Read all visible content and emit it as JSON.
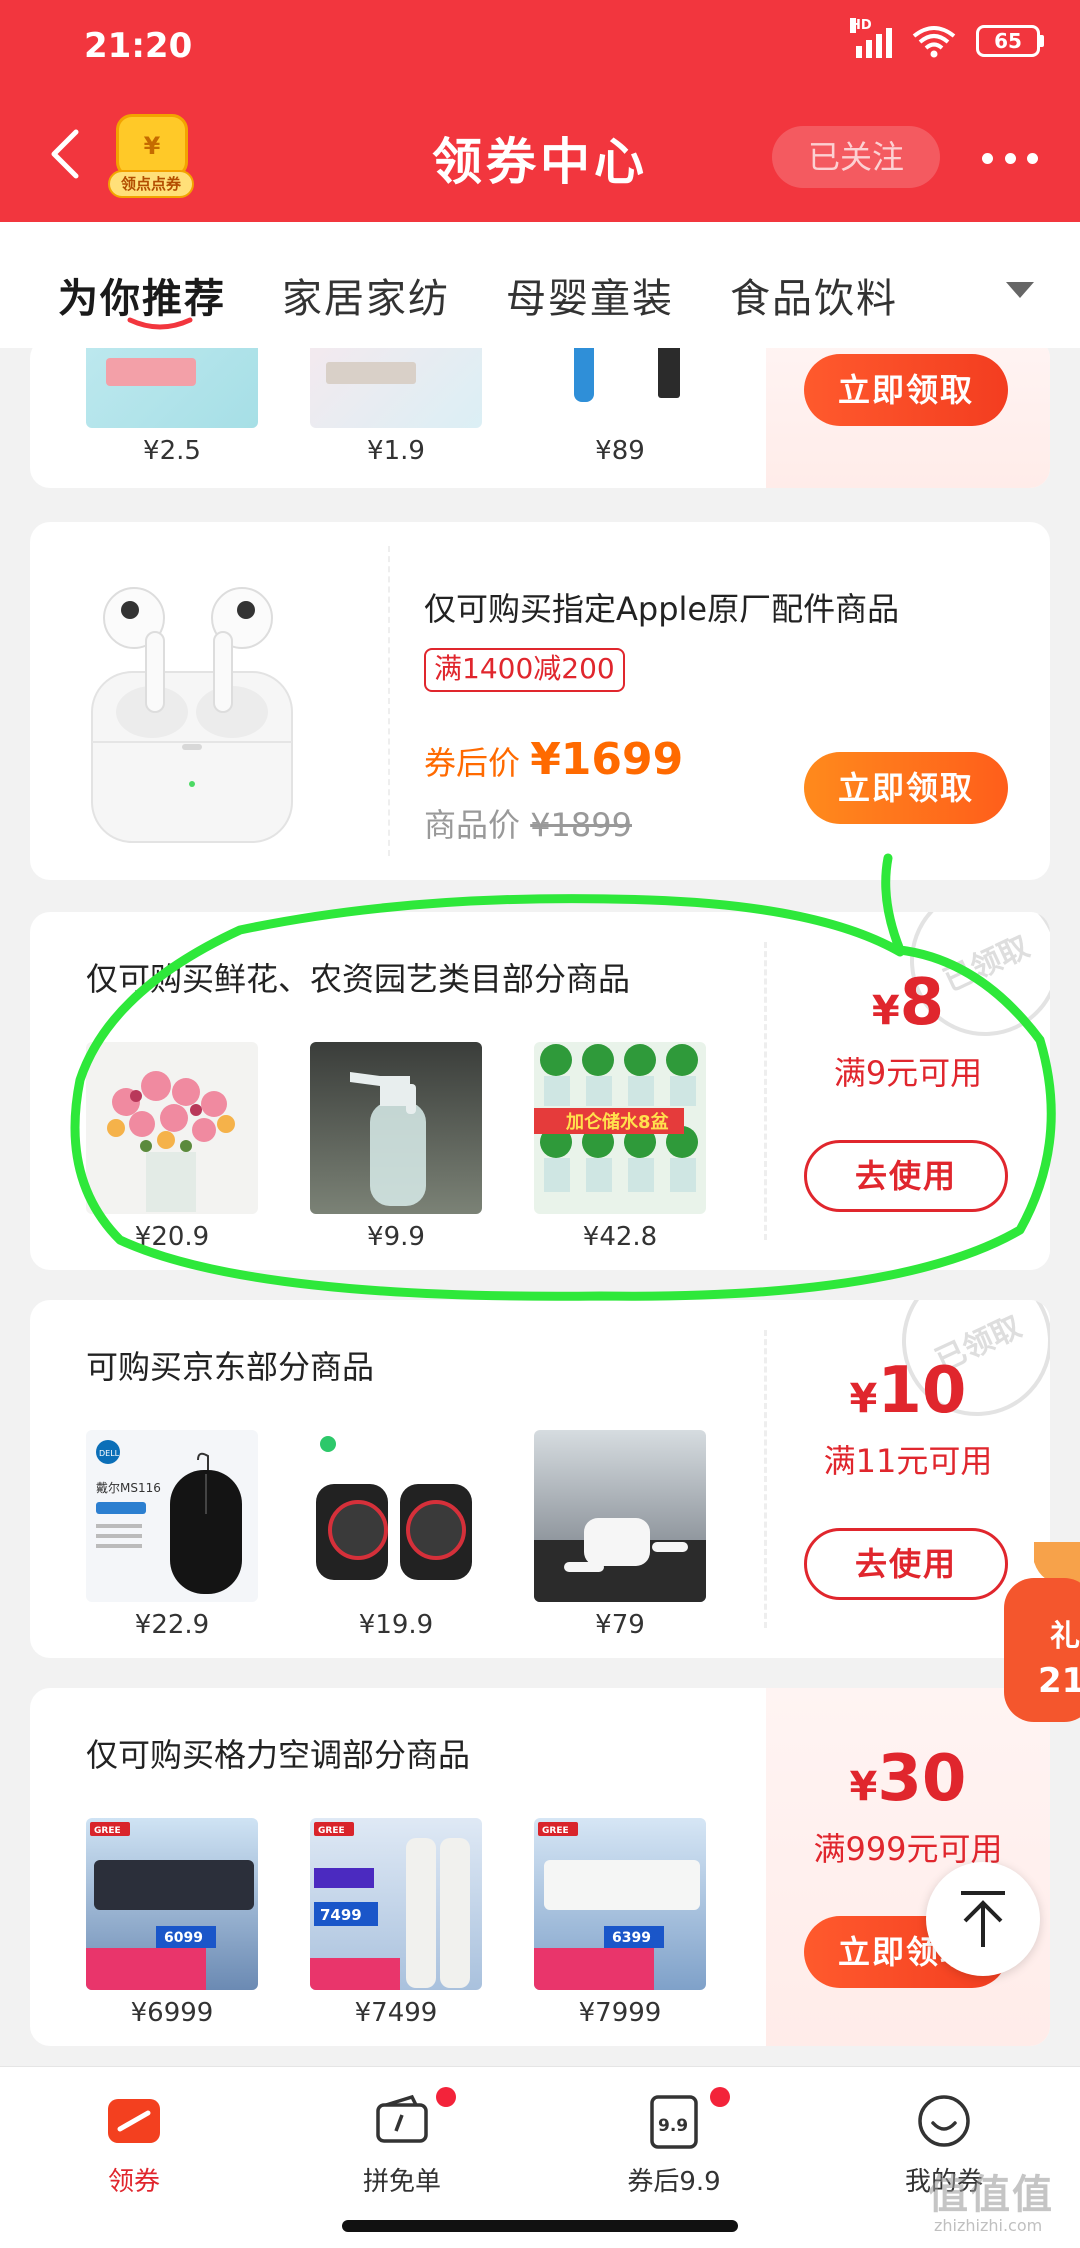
{
  "status_bar": {
    "time": "21:20",
    "network": "HD",
    "battery": "65"
  },
  "header": {
    "title": "领券中心",
    "badge_label": "领点点券",
    "badge_symbol": "¥",
    "follow_label": "已关注"
  },
  "tabs": [
    "为你推荐",
    "家居家纺",
    "母婴童装",
    "食品饮料"
  ],
  "cards": {
    "top_partial": {
      "prices": [
        "¥2.5",
        "¥1.9",
        "¥89"
      ],
      "button": "立即领取"
    },
    "apple": {
      "title": "仅可购买指定Apple原厂配件商品",
      "tag": "满1400减200",
      "after_label": "券后价",
      "after_price": "¥1699",
      "orig_label": "商品价",
      "orig_price": "¥1899",
      "button": "立即领取"
    },
    "flowers": {
      "title": "仅可购买鲜花、农资园艺类目部分商品",
      "prices": [
        "¥20.9",
        "¥9.9",
        "¥42.8"
      ],
      "coupon_symbol": "¥",
      "coupon_value": "8",
      "condition": "满9元可用",
      "button": "去使用",
      "stamp": "已领取",
      "thumb3_banner": "加仑储水8盆"
    },
    "jd": {
      "title": "可购买京东部分商品",
      "prices": [
        "¥22.9",
        "¥19.9",
        "¥79"
      ],
      "coupon_symbol": "¥",
      "coupon_value": "10",
      "condition": "满11元可用",
      "button": "去使用",
      "stamp": "已领取",
      "thumb1_brand": "DELL",
      "thumb1_model": "戴尔MS116"
    },
    "gree": {
      "title": "仅可购买格力空调部分商品",
      "prices": [
        "¥6999",
        "¥7499",
        "¥7999"
      ],
      "coupon_symbol": "¥",
      "coupon_value": "30",
      "condition": "满999元可用",
      "button": "立即领取",
      "thumb_prices": [
        "6099",
        "7499",
        "6399"
      ],
      "thumb_brand": "GREE"
    }
  },
  "float": {
    "gift_text1": "礼",
    "gift_text2": "21"
  },
  "bottom_nav": [
    {
      "label": "领券"
    },
    {
      "label": "拼免单"
    },
    {
      "label": "券后9.9",
      "icon_text": "9.9"
    },
    {
      "label": "我的券"
    }
  ],
  "watermark": {
    "main": "值值值",
    "sub": "zhizhizhi.com"
  },
  "colors": {
    "header": "#f2363e",
    "accent": "#e0262d",
    "orange": "#ff6a00",
    "annotation": "#2ee83a"
  }
}
